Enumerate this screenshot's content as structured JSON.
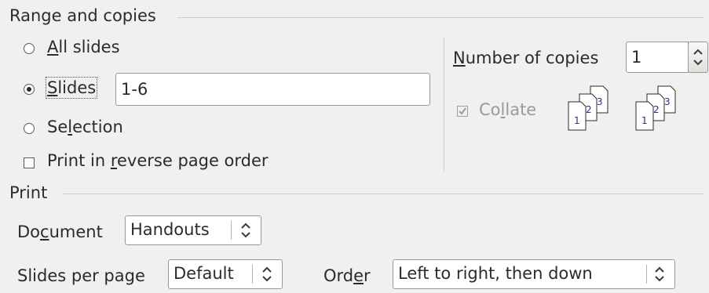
{
  "range_section": {
    "title": "Range and copies",
    "options": {
      "all_slides": {
        "prefix": "",
        "underline": "A",
        "suffix": "ll slides",
        "selected": false
      },
      "slides": {
        "prefix": "",
        "underline": "S",
        "suffix": "lides",
        "selected": true,
        "value": "1-6"
      },
      "selection": {
        "prefix": "Se",
        "underline": "l",
        "suffix": "ection",
        "selected": false
      }
    },
    "reverse_order": {
      "prefix": "Print in ",
      "underline": "r",
      "suffix": "everse page order",
      "checked": false
    },
    "copies": {
      "prefix": "",
      "underline": "N",
      "suffix": "umber of copies",
      "value": "1"
    },
    "collate": {
      "prefix": "Co",
      "underline": "l",
      "suffix": "late",
      "checked": true,
      "disabled": true
    },
    "collate_icon_pages": [
      "1",
      "2",
      "3"
    ]
  },
  "print_section": {
    "title": "Print",
    "document": {
      "prefix": "Do",
      "underline": "c",
      "suffix": "ument",
      "value": "Handouts"
    },
    "slides_per_page": {
      "label": "Slides per page",
      "value": "Default"
    },
    "order": {
      "prefix": "Ord",
      "underline": "e",
      "suffix": "r",
      "value": "Left to right, then down"
    }
  },
  "icons": {
    "select_arrows": "up-down-chevrons-icon",
    "spin": "spin-arrows-icon",
    "collate": "collate-pages-icon"
  }
}
